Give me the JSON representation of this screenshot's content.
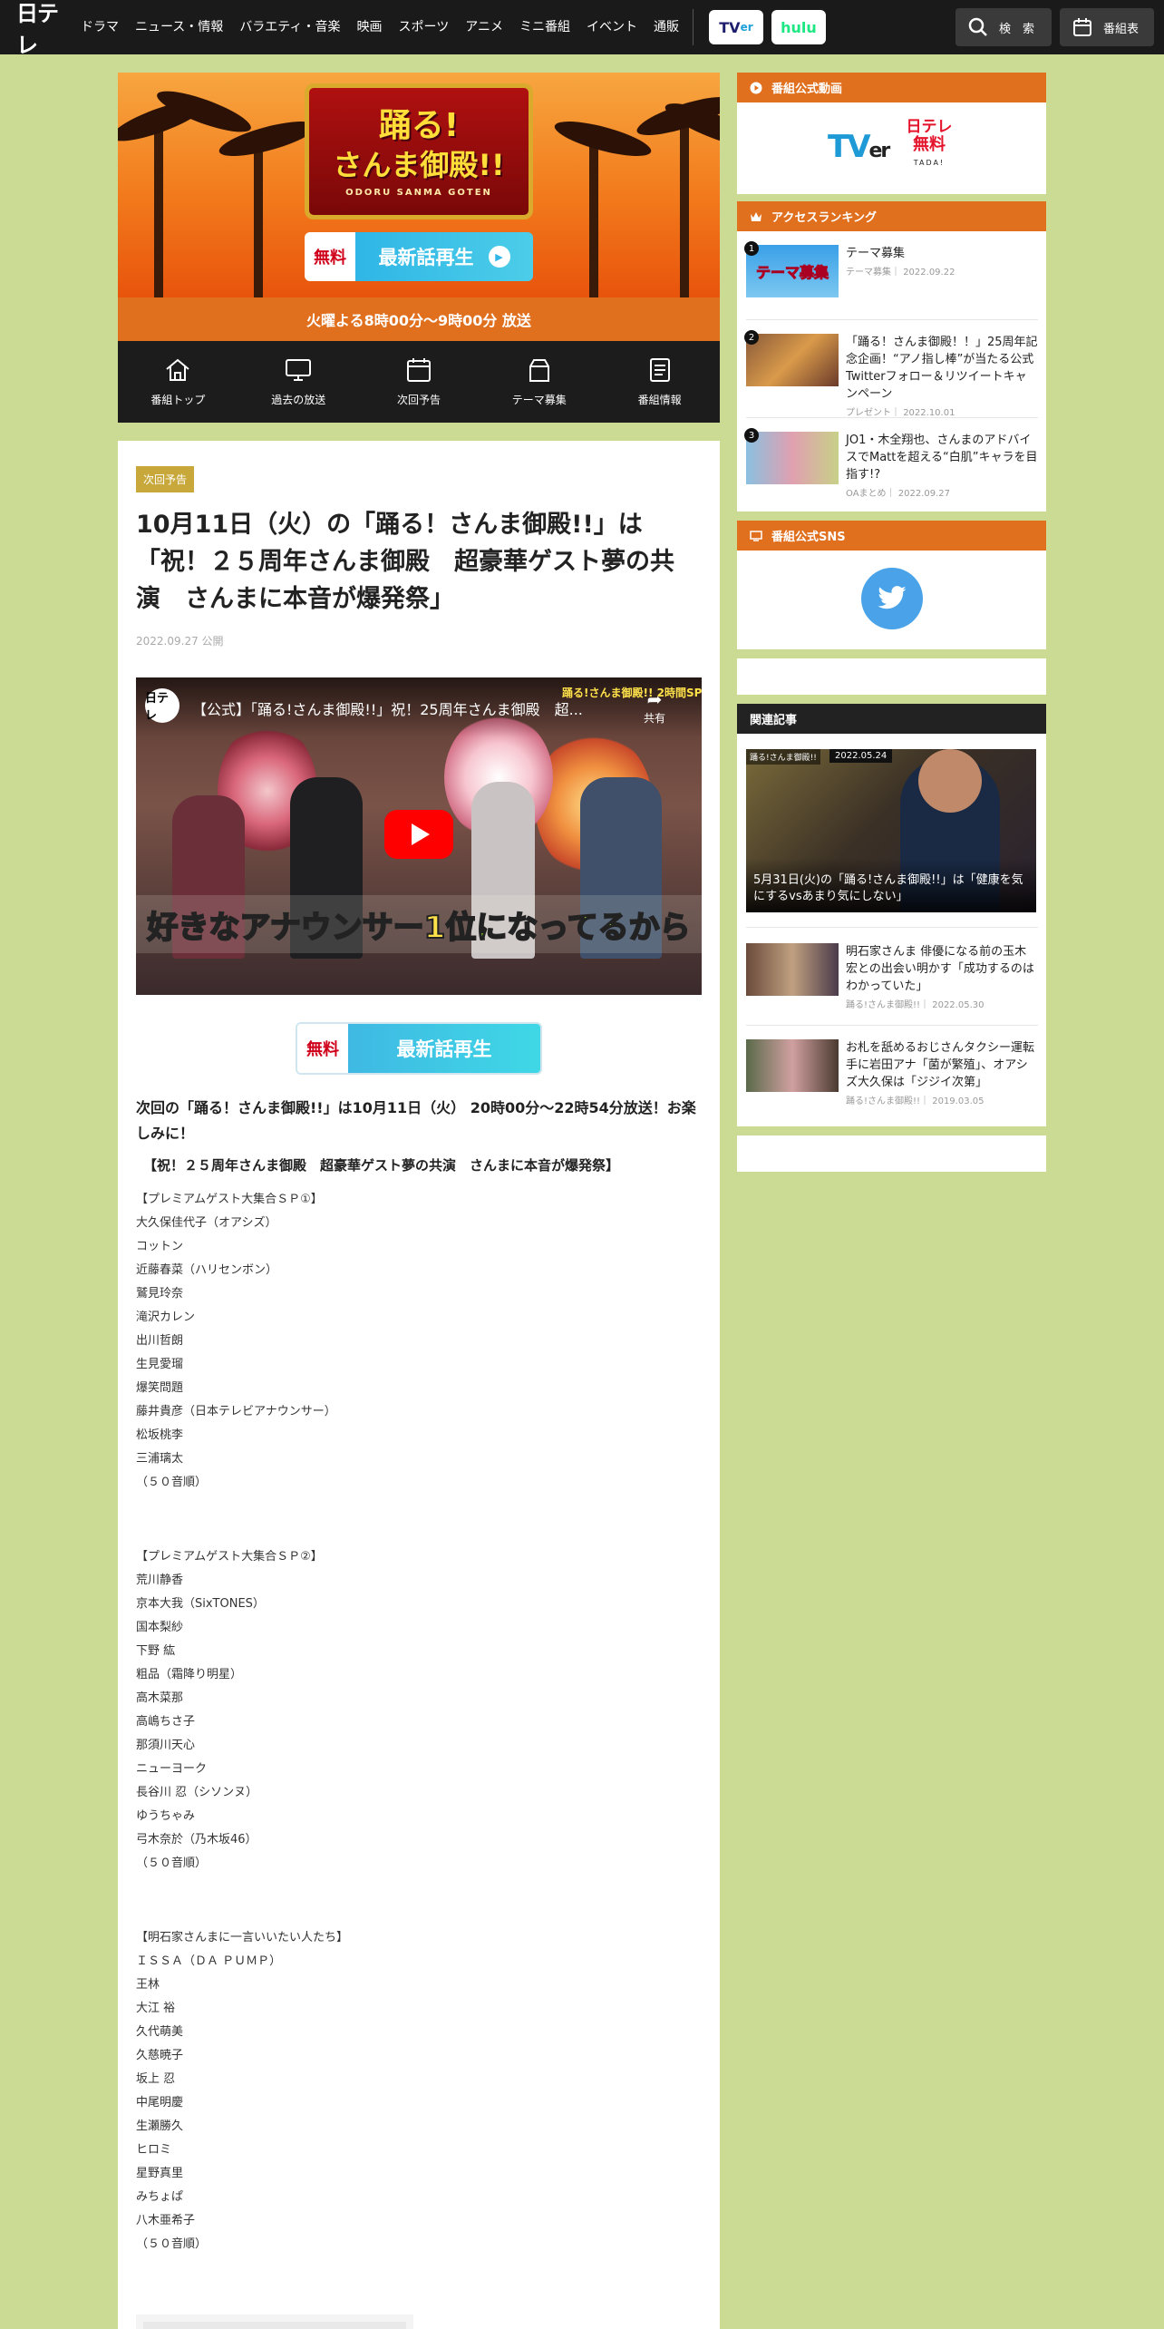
{
  "header": {
    "logo": "日テレ",
    "nav": [
      "ドラマ",
      "ニュース・情報",
      "バラエティ・音楽",
      "映画",
      "スポーツ",
      "アニメ",
      "ミニ番組",
      "イベント",
      "通販"
    ],
    "tver_t": "TV",
    "tver_v": "er",
    "hulu": "hulu",
    "search_label": "検　索",
    "schedule_label": "番組表"
  },
  "hero": {
    "logo_line1": "踊る!",
    "logo_line2": "さんま御殿!!",
    "logo_line3": "ODORU SANMA GOTEN",
    "free_label": "無料",
    "play_label": "最新話再生",
    "airtime": "火曜よる8時00分～9時00分 放送"
  },
  "program_nav": [
    {
      "label": "番組トップ",
      "icon": "home-icon"
    },
    {
      "label": "過去の放送",
      "icon": "monitor-icon"
    },
    {
      "label": "次回予告",
      "icon": "calendar-icon"
    },
    {
      "label": "テーマ募集",
      "icon": "box-icon"
    },
    {
      "label": "番組情報",
      "icon": "document-icon"
    }
  ],
  "article": {
    "tag": "次回予告",
    "title": "10月11日（火）の「踊る！さんま御殿!!」は「祝！２５周年さんま御殿　超豪華ゲスト夢の共演　さんまに本音が爆発祭」",
    "date": "2022.09.27 公開",
    "video": {
      "channel": "日テレ",
      "title": "【公式】「踊る!さんま御殿!!」祝！25周年さんま御殿　超...",
      "share": "共有",
      "corner_badge": "踊る!さんま御殿!! 2時間SP",
      "telop_a": "好きなアナウンサー1位",
      "telop_b": "になってるから"
    },
    "free_label": "無料",
    "play_label": "最新話再生",
    "lead": "次回の「踊る！さんま御殿!!」は10月11日（火） 20時00分～22時54分放送！お楽しみに！",
    "subtitle": "【祝！２５周年さんま御殿　超豪華ゲスト夢の共演　さんまに本音が爆発祭】",
    "list1": [
      "【プレミアムゲスト大集合ＳＰ①】",
      "大久保佳代子（オアシズ）",
      "コットン",
      "近藤春菜（ハリセンボン）",
      "鷲見玲奈",
      "滝沢カレン",
      "出川哲朗",
      "生見愛瑠",
      "爆笑問題",
      "藤井貴彦（日本テレビアナウンサー）",
      "松坂桃李",
      "三浦璃太",
      "（５０音順）"
    ],
    "list2": [
      "【プレミアムゲスト大集合ＳＰ②】",
      "荒川静香",
      "京本大我（SixTONES）",
      "国本梨紗",
      "下野 紘",
      "粗品（霜降り明星）",
      "高木菜那",
      "高嶋ちさ子",
      "那須川天心",
      "ニューヨーク",
      "長谷川 忍（シソンヌ）",
      "ゆうちゃみ",
      "弓木奈於（乃木坂46）",
      "（５０音順）"
    ],
    "list3": [
      "【明石家さんまに一言いいたい人たち】",
      "ＩＳＳＡ（ＤＡ ＰＵＭＰ）",
      "王林",
      "大江 裕",
      "久代萌美",
      "久慈暁子",
      "坂上 忍",
      "中尾明慶",
      "生瀬勝久",
      "ヒロミ",
      "星野真里",
      "みちょぱ",
      "八木亜希子",
      "（５０音順）"
    ]
  },
  "sidebar": {
    "official_video": {
      "heading": "番組公式動画",
      "tver_t": "TV",
      "tver_v": "er",
      "ntv_logo": "日テレ",
      "ntv_free": "無料",
      "ntv_tada": "TADA!"
    },
    "ranking": {
      "heading": "アクセスランキング",
      "items": [
        {
          "num": "1",
          "title": "テーマ募集",
          "category": "テーマ募集",
          "date": "2022.09.22",
          "thumb_text": "テーマ募集"
        },
        {
          "num": "2",
          "title": "「踊る！さんま御殿！！」25周年記念企画！“アノ指し棒”が当たる公式Twitterフォロー＆リツイートキャンペーン",
          "category": "プレゼント",
          "date": "2022.10.01",
          "thumb_text": ""
        },
        {
          "num": "3",
          "title": "JO1・木全翔也、さんまのアドバイスでMattを超える“白肌”キャラを目指す!?",
          "category": "OAまとめ",
          "date": "2022.09.27",
          "thumb_text": ""
        }
      ]
    },
    "sns": {
      "heading": "番組公式SNS",
      "icon": "twitter-icon"
    },
    "related": {
      "heading": "関連記事",
      "feature": {
        "label": "踊る!さんま御殿!!",
        "date": "2022.05.24",
        "caption": "5月31日(火)の「踊る!さんま御殿!!」は「健康を気にするvsあまり気にしない」"
      },
      "items": [
        {
          "title": "明石家さんま 俳優になる前の玉木宏との出会い明かす「成功するのはわかっていた」",
          "category": "踊る!さんま御殿!!",
          "date": "2022.05.30"
        },
        {
          "title": "お札を舐めるおじさんタクシー運転手に岩田アナ「菌が繁殖」、オアシズ大久保は「ジジイ次第」",
          "category": "踊る!さんま御殿!!",
          "date": "2019.03.05"
        }
      ]
    }
  },
  "colors": {
    "page_bg": "#cbdb93",
    "header_bg": "#1a1a1a",
    "accent_orange": "#e06f1e",
    "play_blue": "#2fb6e6",
    "twitter": "#4aa3e8"
  }
}
